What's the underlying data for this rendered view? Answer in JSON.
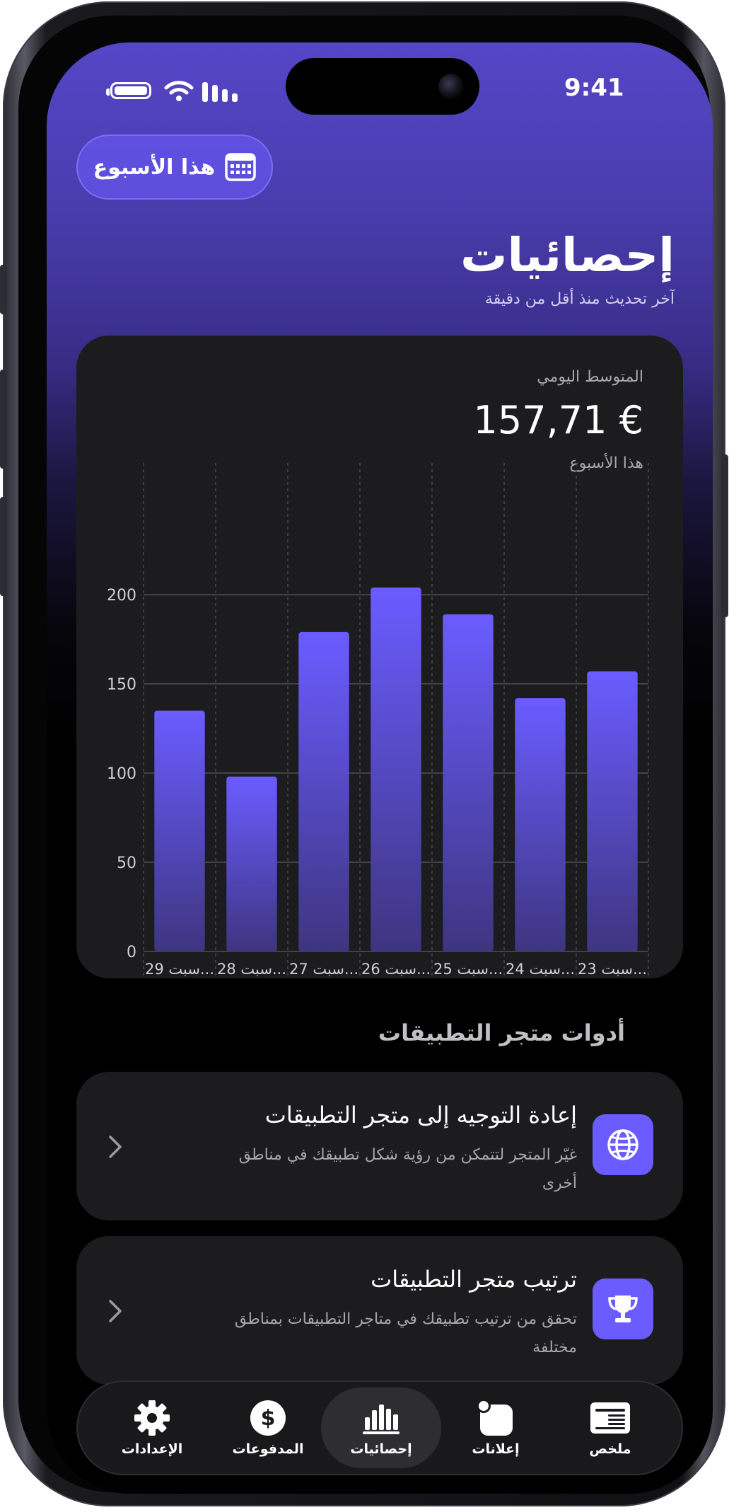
{
  "status_bar": {
    "time": "9:41"
  },
  "header": {
    "period_button": "هذا الأسبوع",
    "title": "إحصائيات",
    "subtitle": "آخر تحديث منذ أقل من دقيقة"
  },
  "chart_card": {
    "label": "المتوسط اليومي",
    "value": "157,71 €",
    "period": "هذا الأسبوع"
  },
  "chart_data": {
    "type": "bar",
    "categories": [
      "29 سبت...",
      "28 سبت...",
      "27 سبت...",
      "26 سبت...",
      "25 سبت...",
      "24 سبت...",
      "23 سبت..."
    ],
    "values": [
      135,
      98,
      179,
      204,
      189,
      142,
      157
    ],
    "ylim": [
      0,
      250
    ],
    "yticks": [
      0,
      50,
      100,
      150,
      200
    ],
    "grid": true,
    "bar_color": "#6a5cff"
  },
  "tools": {
    "section_title": "أدوات متجر التطبيقات",
    "items": [
      {
        "title": "إعادة التوجيه إلى متجر التطبيقات",
        "description": "غيّر المتجر لتتمكن من رؤية شكل تطبيقك في مناطق أخرى",
        "icon": "globe-icon"
      },
      {
        "title": "ترتيب متجر التطبيقات",
        "description": "تحقق من ترتيب تطبيقك في متاجر التطبيقات بمناطق مختلفة",
        "icon": "trophy-icon"
      }
    ]
  },
  "tabbar": {
    "items": [
      {
        "label": "الإعدادات",
        "icon": "gear-icon"
      },
      {
        "label": "المدفوعات",
        "icon": "dollar-icon"
      },
      {
        "label": "إحصائيات",
        "icon": "bar-chart-icon",
        "active": true
      },
      {
        "label": "إعلانات",
        "icon": "notification-icon"
      },
      {
        "label": "ملخص",
        "icon": "summary-icon"
      }
    ]
  },
  "colors": {
    "accent": "#6a5cff",
    "card": "#1c1c1e",
    "header_top": "#5546c7"
  }
}
